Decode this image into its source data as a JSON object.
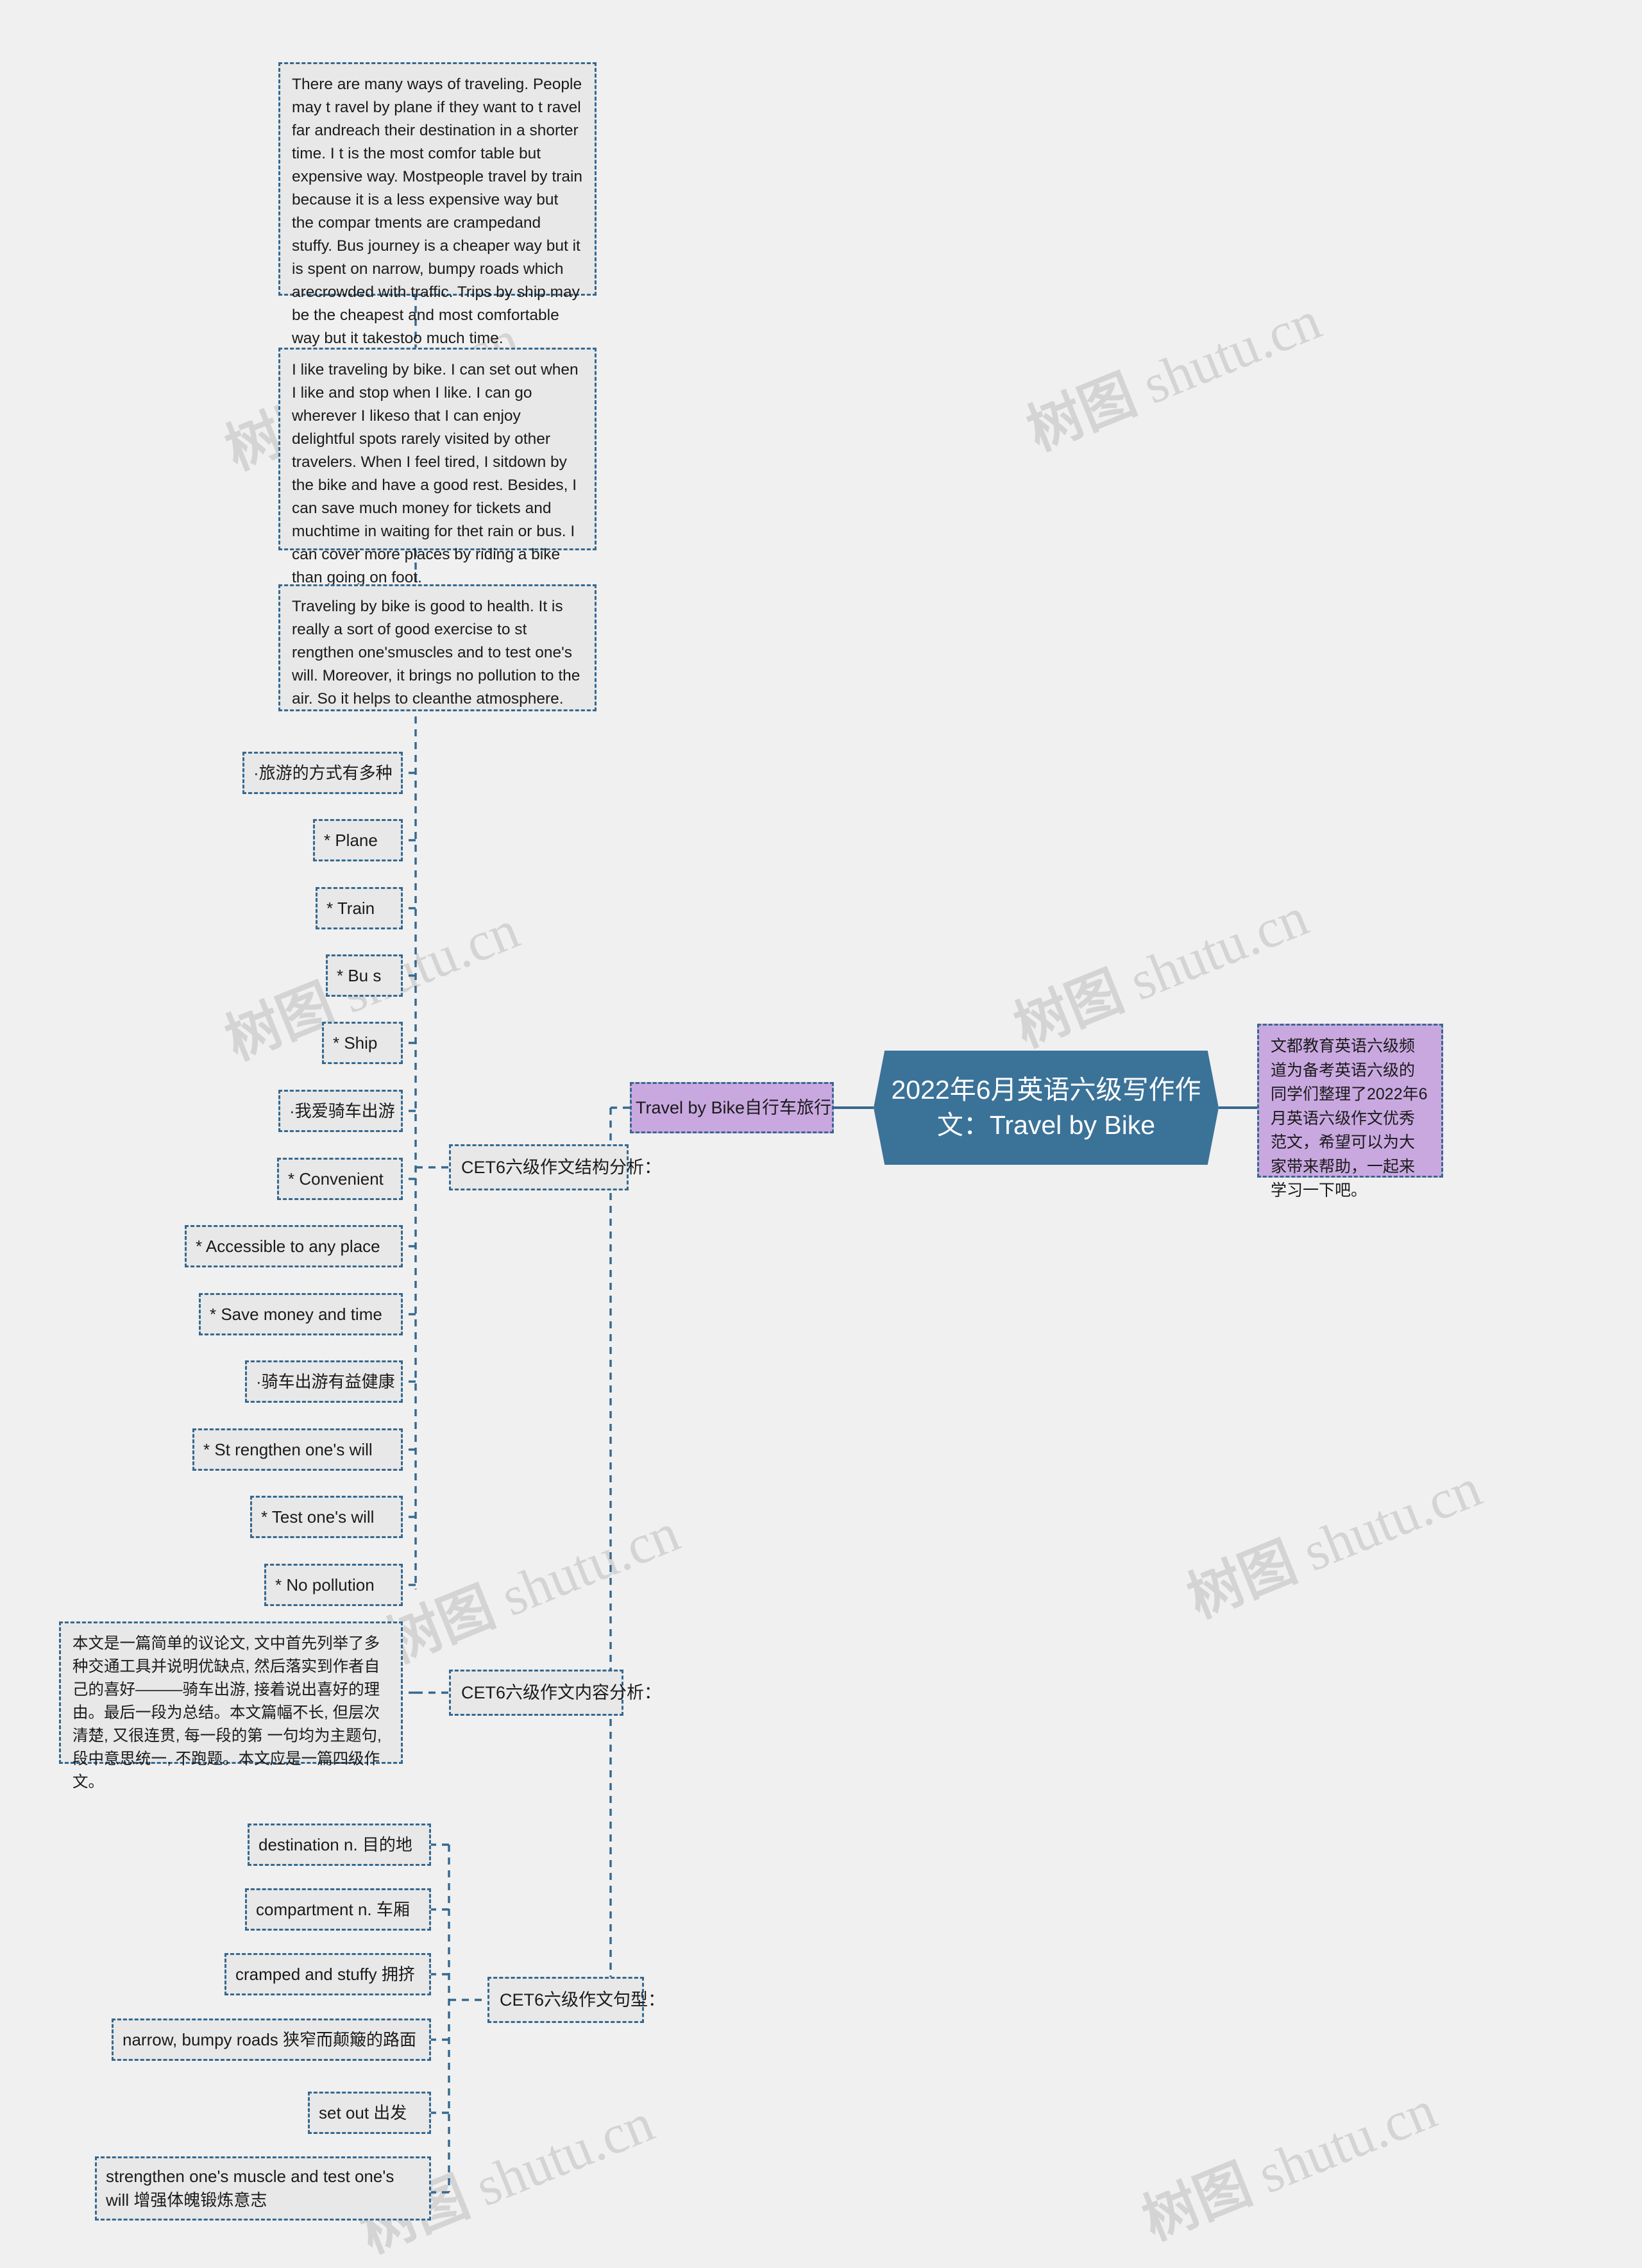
{
  "root": {
    "label": "2022年6月英语六级写作作文：Travel by Bike",
    "color": "#3b7298",
    "text_color": "#ffffff"
  },
  "right_branch": {
    "intro": "文都教育英语六级频道为备考英语六级的同学们整理了2022年6月英语六级作文优秀范文，希望可以为大家带来帮助，一起来学习一下吧。",
    "color": "#c9a8e0"
  },
  "left_branch": {
    "title": "Travel by Bike自行车旅行",
    "color": "#c9a8e0"
  },
  "sections": {
    "essay": {
      "paragraphs": [
        "There are many ways of traveling. People may t ravel by plane if they want to t ravel far andreach their destination in a shorter time. I t is the most comfor table but expensive way. Mostpeople travel by train because it is a less expensive way but the compar tments are crampedand stuffy. Bus journey is a cheaper way but it is spent on narrow, bumpy roads which arecrowded with traffic. Trips by ship may be the cheapest and most comfortable way but it takestoo much time.",
        "I like traveling by bike. I can set out when I like and stop when I like. I can go wherever I likeso that I can enjoy delightful spots rarely visited by other travelers. When I feel tired, I sitdown by the bike and have a good rest. Besides, I can save much money for tickets and muchtime in waiting for thet rain or bus. I can cover more places by riding a bike than going on foot.",
        "Traveling by bike is good to health. It is really a sort of good exercise to st rengthen one'smuscles and to test one's will. Moreover, it brings no pollution to the air. So it helps to cleanthe atmosphere."
      ]
    },
    "structure": {
      "title": "CET6六级作文结构分析：",
      "items": [
        "·旅游的方式有多种",
        "* Plane",
        "* Train",
        "* Bu s",
        "* Ship",
        "·我爱骑车出游",
        "* Convenient",
        "* Accessible to any place",
        "* Save money and time",
        "·骑车出游有益健康",
        "* St rengthen one's will",
        "* Test one's will",
        "* No pollution"
      ]
    },
    "content_analysis": {
      "title": "CET6六级作文内容分析：",
      "body": "本文是一篇简单的议论文, 文中首先列举了多种交通工具并说明优缺点, 然后落实到作者自己的喜好———骑车出游, 接着说出喜好的理由。最后一段为总结。本文篇幅不长, 但层次清楚, 又很连贯, 每一段的第 一句均为主题句, 段中意思统一, 不跑题。本文应是一篇四级作文。"
    },
    "sentence_patterns": {
      "title": "CET6六级作文句型：",
      "items": [
        "destination n. 目的地",
        "compartment n. 车厢",
        "cramped and stuffy 拥挤",
        "narrow, bumpy roads 狭窄而颠簸的路面",
        "set out 出发",
        "strengthen one's muscle and test one's will 增强体魄锻炼意志"
      ]
    }
  },
  "watermarks": [
    "树图 shutu.cn",
    "树图 shutu.cn",
    "树图 shutu.cn",
    "树图 shutu.cn",
    "树图 shutu.cn",
    "树图 shutu.cn",
    "树图 shutu.cn",
    "树图 shutu.cn"
  ]
}
